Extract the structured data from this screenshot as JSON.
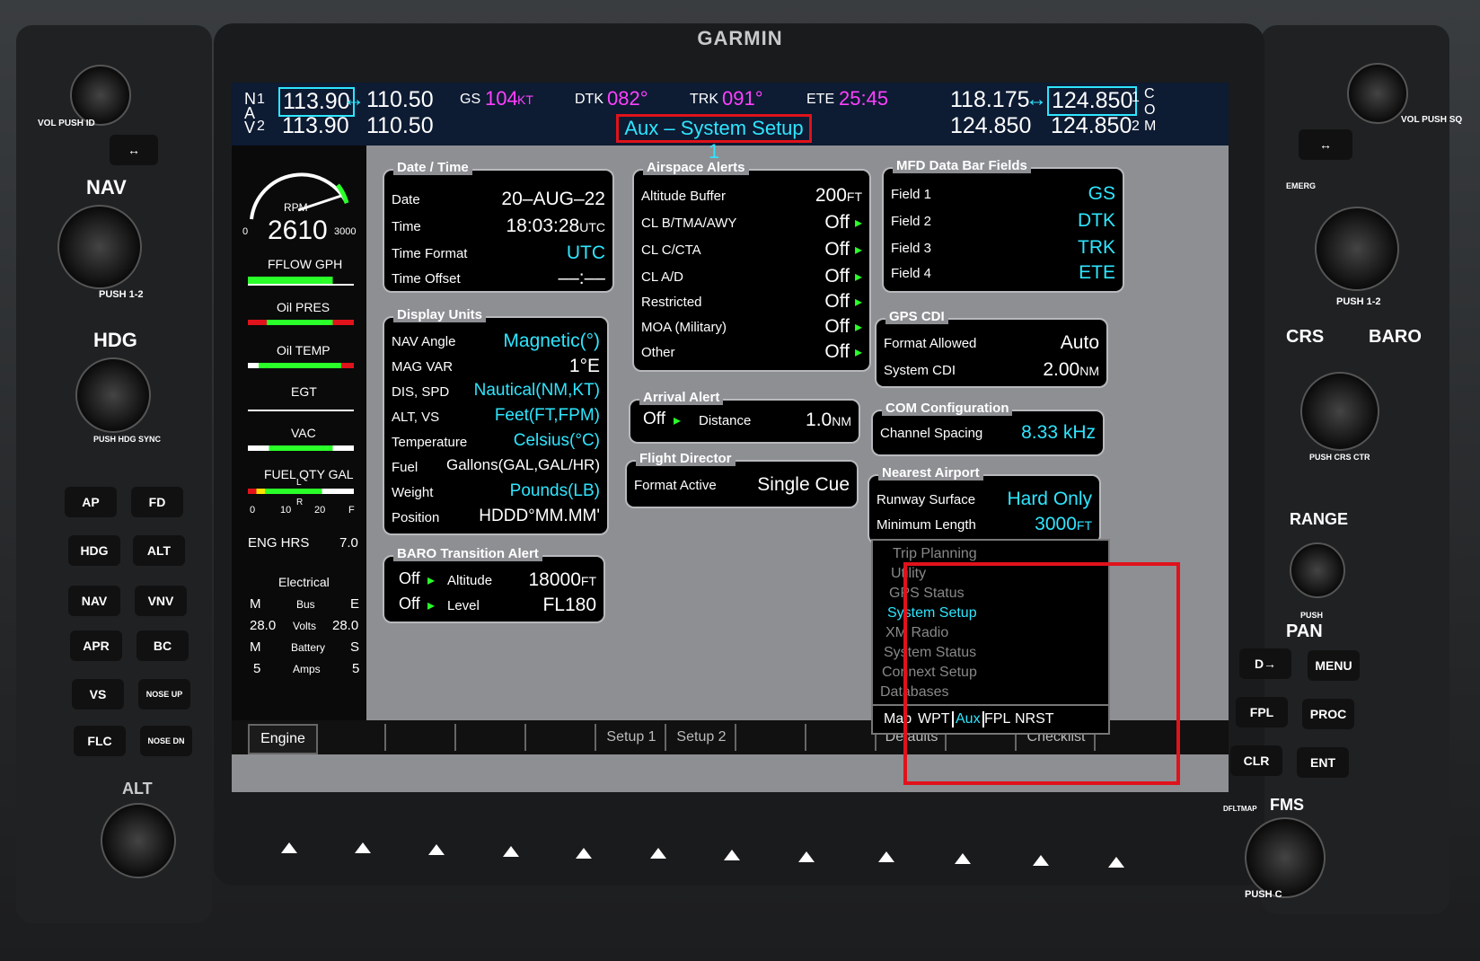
{
  "brand": "GARMIN",
  "nav": {
    "label_n": "N",
    "label_a": "A",
    "label_v": "V",
    "n1_num": "1",
    "n2_num": "2",
    "nav1_active": "113.90",
    "swap_arrow": "↔",
    "nav1_standby": "110.50",
    "nav2_active": "113.90",
    "nav2_standby": "110.50"
  },
  "databar": {
    "gs_label": "GS",
    "gs_value": "104",
    "gs_unit": "KT",
    "dtk_label": "DTK",
    "dtk_value": "082°",
    "trk_label": "TRK",
    "trk_value": "091°",
    "ete_label": "ETE",
    "ete_value": "25:45"
  },
  "com": {
    "com1_active": "118.175",
    "swap_arrow": "↔",
    "com1_standby": "124.850",
    "com2_active": "124.850",
    "com2_standby": "124.850",
    "side_1": "1",
    "side_c": "C",
    "side_o": "O",
    "side_2": "2",
    "side_m": "M"
  },
  "page_title": "Aux – System Setup 1",
  "engine": {
    "rpm_label": "RPM",
    "rpm_value": "2610",
    "rpm_min": "0",
    "rpm_max": "3000",
    "fflow_label": "FFLOW GPH",
    "oil_pres_label": "Oil PRES",
    "oil_temp_label": "Oil TEMP",
    "egt_label": "EGT",
    "vac_label": "VAC",
    "fuel_label": "FUEL QTY GAL",
    "fuel_t0": "0",
    "fuel_t10": "10",
    "fuel_t20": "20",
    "fuel_tf": "F",
    "fuel_l": "L",
    "fuel_r": "R",
    "eng_hrs_label": "ENG HRS",
    "eng_hrs_value": "7.0",
    "electrical_label": "Electrical",
    "m1": "M",
    "bus": "Bus",
    "e1": "E",
    "volts_l": "28.0",
    "volts": "Volts",
    "volts_r": "28.0",
    "m2": "M",
    "battery": "Battery",
    "s": "S",
    "amps_l": "5",
    "amps": "Amps",
    "amps_r": "5"
  },
  "date_time": {
    "title": "Date / Time",
    "date_label": "Date",
    "date_value": "20–AUG–22",
    "time_label": "Time",
    "time_value": "18:03:28",
    "time_unit": "UTC",
    "format_label": "Time Format",
    "format_value": "UTC",
    "offset_label": "Time Offset",
    "offset_value": "––:––"
  },
  "display_units": {
    "title": "Display Units",
    "rows": [
      {
        "label": "NAV Angle",
        "value": "Magnetic(°)"
      },
      {
        "label": "MAG VAR",
        "value": "1°E"
      },
      {
        "label": "DIS, SPD",
        "value": "Nautical(NM,KT)"
      },
      {
        "label": "ALT, VS",
        "value": "Feet(FT,FPM)"
      },
      {
        "label": "Temperature",
        "value": "Celsius(°C)"
      },
      {
        "label": "Fuel",
        "value": "Gallons(GAL,GAL/HR)"
      },
      {
        "label": "Weight",
        "value": "Pounds(LB)"
      },
      {
        "label": "Position",
        "value": "HDDD°MM.MM'"
      }
    ]
  },
  "baro": {
    "title": "BARO Transition Alert",
    "altitude_state": "Off",
    "altitude_label": "Altitude",
    "altitude_value": "18000",
    "altitude_unit": "FT",
    "level_state": "Off",
    "level_label": "Level",
    "level_value": "FL180"
  },
  "airspace": {
    "title": "Airspace Alerts",
    "buffer_label": "Altitude Buffer",
    "buffer_value": "200",
    "buffer_unit": "FT",
    "rows": [
      {
        "label": "CL B/TMA/AWY",
        "value": "Off"
      },
      {
        "label": "CL C/CTA",
        "value": "Off"
      },
      {
        "label": "CL A/D",
        "value": "Off"
      },
      {
        "label": "Restricted",
        "value": "Off"
      },
      {
        "label": "MOA (Military)",
        "value": "Off"
      },
      {
        "label": "Other",
        "value": "Off"
      }
    ]
  },
  "arrival": {
    "title": "Arrival Alert",
    "state": "Off",
    "distance_label": "Distance",
    "distance_value": "1.0",
    "distance_unit": "NM"
  },
  "flight_director": {
    "title": "Flight Director",
    "label": "Format Active",
    "value": "Single Cue"
  },
  "mfd_fields": {
    "title": "MFD Data Bar Fields",
    "rows": [
      {
        "label": "Field 1",
        "value": "GS"
      },
      {
        "label": "Field 2",
        "value": "DTK"
      },
      {
        "label": "Field 3",
        "value": "TRK"
      },
      {
        "label": "Field 4",
        "value": "ETE"
      }
    ]
  },
  "gps_cdi": {
    "title": "GPS CDI",
    "format_label": "Format Allowed",
    "format_value": "Auto",
    "cdi_label": "System CDI",
    "cdi_value": "2.00",
    "cdi_unit": "NM"
  },
  "com_config": {
    "title": "COM Configuration",
    "label": "Channel Spacing",
    "value": "8.33 kHz"
  },
  "nearest": {
    "title": "Nearest Airport",
    "surface_label": "Runway Surface",
    "surface_value": "Hard Only",
    "length_label": "Minimum Length",
    "length_value": "3000",
    "length_unit": "FT"
  },
  "aux_menu": {
    "items": [
      "Trip Planning",
      "Utility",
      "GPS Status",
      "System Setup",
      "XM Radio",
      "System Status",
      "Connext Setup",
      "Databases"
    ],
    "selected": "System Setup",
    "tabs": [
      "Map",
      "WPT",
      "Aux",
      "FPL",
      "NRST"
    ]
  },
  "softkeys": {
    "engine": "Engine",
    "setup1": "Setup 1",
    "setup2": "Setup 2",
    "defaults": "Defaults",
    "checklist": "Checklist"
  },
  "left_buttons": {
    "vol_push_id": "VOL PUSH ID",
    "nav": "NAV",
    "push12": "PUSH 1-2",
    "hdg": "HDG",
    "push_hdg_sync": "PUSH HDG SYNC",
    "ap": "AP",
    "fd": "FD",
    "hdg_btn": "HDG",
    "alt": "ALT",
    "nav_btn": "NAV",
    "vnv": "VNV",
    "apr": "APR",
    "bc": "BC",
    "vs": "VS",
    "nose_up": "NOSE UP",
    "flc": "FLC",
    "nose_dn": "NOSE DN",
    "alt_knob": "ALT"
  },
  "right_buttons": {
    "vol_push_sq": "VOL PUSH SQ",
    "emerg": "EMERG",
    "push12": "PUSH 1-2",
    "crs_baro": "CRS",
    "baro": "BARO",
    "push_crs_ctr": "PUSH CRS CTR",
    "range": "RANGE",
    "push": "PUSH",
    "pan": "PAN",
    "direct": "D→",
    "menu": "MENU",
    "fpl": "FPL",
    "proc": "PROC",
    "clr": "CLR",
    "ent": "ENT",
    "dfltmap": "DFLTMAP",
    "fms": "FMS",
    "push_crsr": "PUSH C"
  }
}
